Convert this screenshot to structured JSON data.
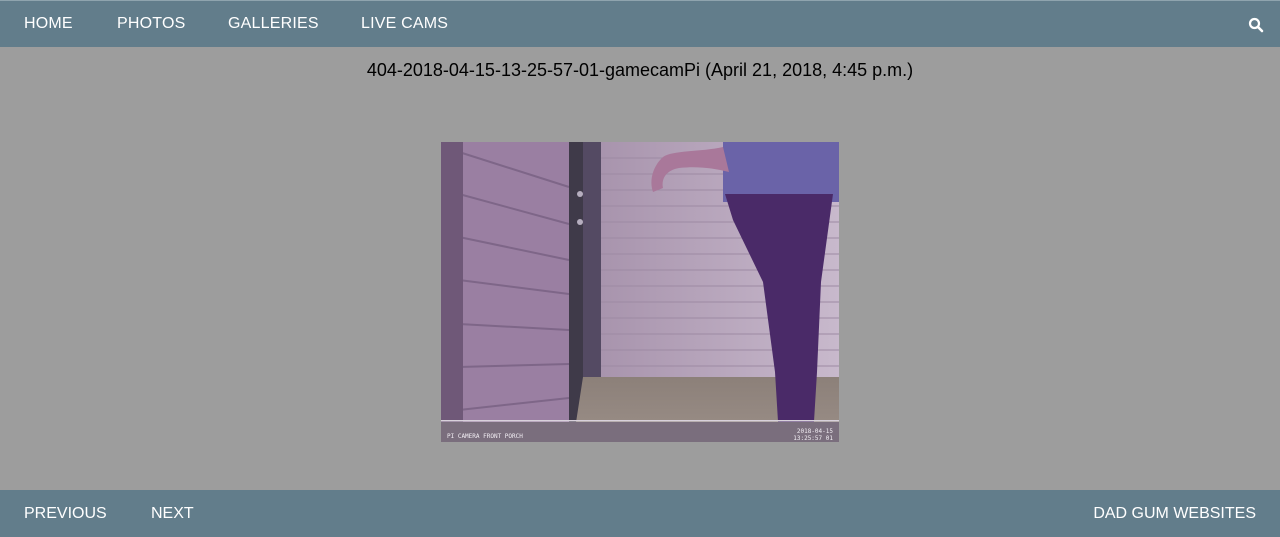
{
  "nav": {
    "home": "HOME",
    "photos": "PHOTOS",
    "galleries": "GALLERIES",
    "live_cams": "LIVE CAMS",
    "search_icon": "search-icon"
  },
  "photo": {
    "title": "404-2018-04-15-13-25-57-01-gamecamPi (April 21, 2018, 4:45 p.m.)",
    "overlay_left": "PI CAMERA FRONT PORCH",
    "overlay_right_date": "2018-04-15",
    "overlay_right_time": "13:25:57 01"
  },
  "footer": {
    "previous": "PREVIOUS",
    "next": "NEXT",
    "brand": "DAD GUM WEBSITES"
  },
  "colors": {
    "bar": "#627d8b",
    "background": "#9d9d9d"
  }
}
